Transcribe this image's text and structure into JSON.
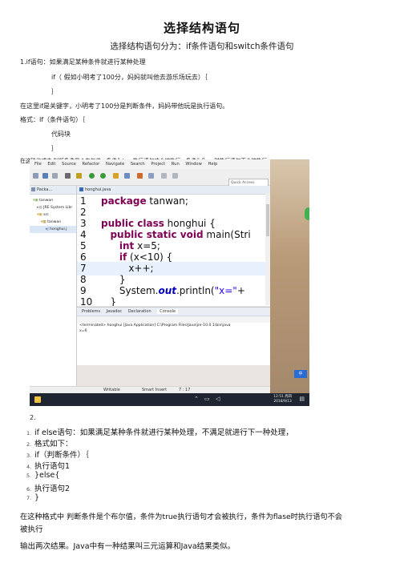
{
  "doc": {
    "title": "选择结构语句",
    "subtitle": "选择结构语句分为：if条件语句和switch条件语句",
    "p1": "1.if语句：如果满足某种条件就进行某种处理",
    "p2": "if（ 假如小明考了100分，妈妈就叫他去游乐场玩去）｛",
    "p3": "｝",
    "p4": "在这里if是关键字，小明考了100分是判断条件，妈妈带他玩是执行语句。",
    "p5": "格式：If（条件语句）｛",
    "p6": "代码块",
    "p7": "｝",
    "p8": "在这种格式中 判断条件是个布尔值，条件为true执行语句才会被执行，条件为flase时执行语句不会被执行。",
    "label2": "2.",
    "list": [
      {
        "num": "1.",
        "text": "if else语句：如果满足某种条件就进行某种处理，不满足就进行下一种处理，"
      },
      {
        "num": "2.",
        "text": "格式如下："
      },
      {
        "num": "3.",
        "text": "if（判断条件）｛"
      },
      {
        "num": "4.",
        "text": "执行语句1"
      },
      {
        "num": "5.",
        "text": "}else{"
      },
      {
        "num": "6.",
        "text": "执行语句2"
      },
      {
        "num": "7.",
        "text": "}"
      }
    ],
    "p9a": "在这种格式中 判断条件是个布尔值，条件为true执行语句才会被执行，条件为flase时执行语句不会",
    "p9b": "被执行",
    "p10": "输出两次结果。Java中有一种结果叫三元运算和Java结果类似。"
  },
  "screenshot": {
    "menu": [
      "File",
      "Edit",
      "Source",
      "Refactor",
      "Navigate",
      "Search",
      "Project",
      "Run",
      "Window",
      "Help"
    ],
    "quick_access": "Quick Access",
    "package_tab": "Packa...",
    "tree": [
      "tanwan",
      "JRE System Libr",
      "src",
      "tanwan",
      "honghui.j"
    ],
    "editor_tab": "honghui.java",
    "code": [
      {
        "n": "1",
        "t": "package tanwan;"
      },
      {
        "n": "2",
        "t": ""
      },
      {
        "n": "3",
        "t": "public class honghui {"
      },
      {
        "n": "4",
        "t": "public static void main(Stri"
      },
      {
        "n": "5",
        "t": "int x=5;"
      },
      {
        "n": "6",
        "t": "if (x<10) {"
      },
      {
        "n": "7",
        "t": "x++;"
      },
      {
        "n": "8",
        "t": "}"
      },
      {
        "n": "9",
        "t": "System.out.println(\"x=\"+"
      },
      {
        "n": "10",
        "t": "}"
      }
    ],
    "bottom_tabs": [
      "Problems",
      "Javadoc",
      "Declaration",
      "Console"
    ],
    "console_line1": "<terminated> honghui [Java Application] C:\\Program Files\\Java\\jre-10.0.1\\bin\\java",
    "console_line2": "x=6",
    "status": [
      "Writable",
      "Smart Insert",
      "7 : 17"
    ],
    "ime": "中",
    "clock_time": "12:51 周四",
    "clock_date": "2018/9/13"
  }
}
